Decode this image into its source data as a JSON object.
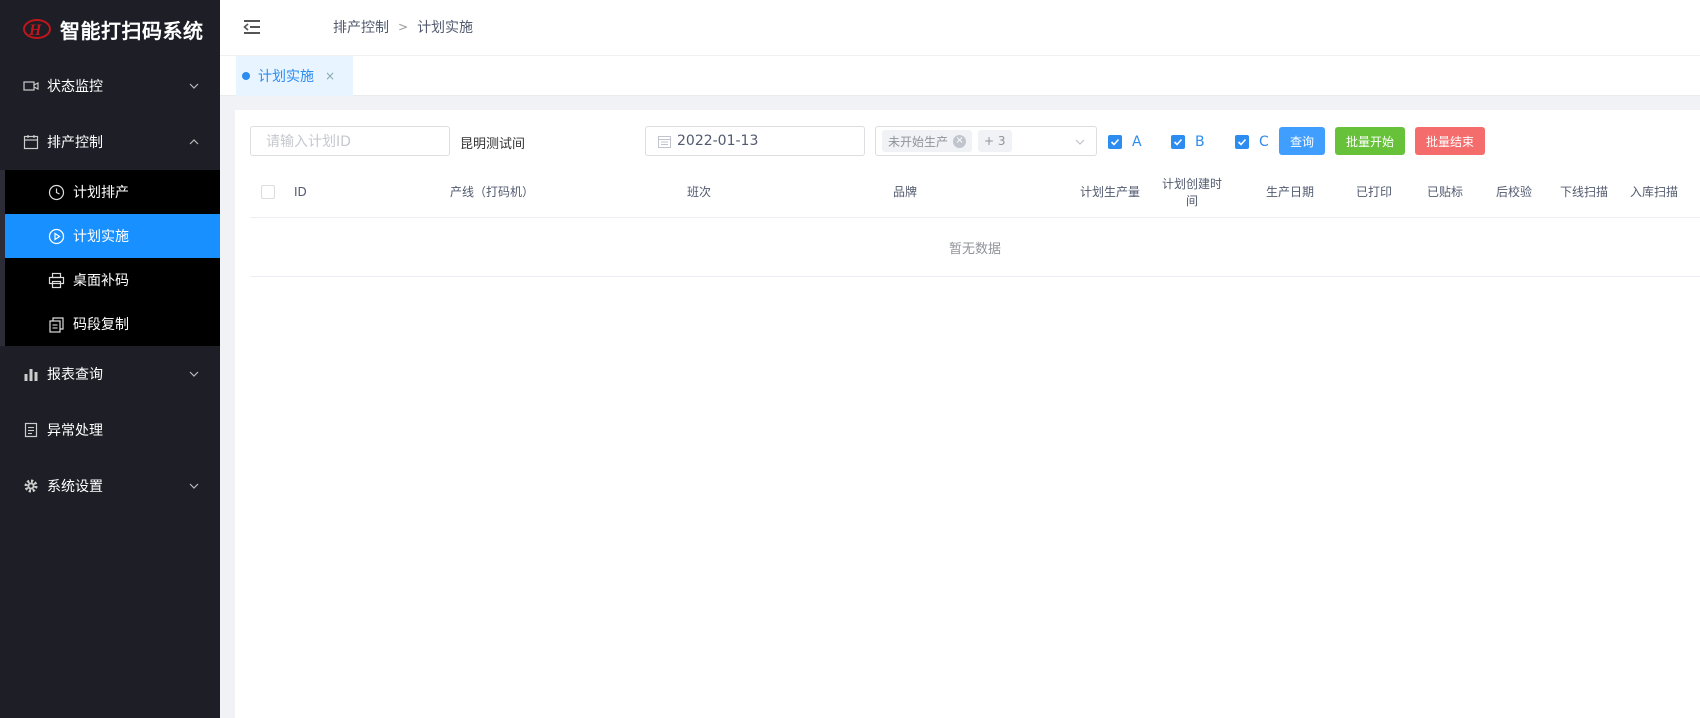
{
  "app": {
    "title": "智能打扫码系统"
  },
  "sidebar": {
    "items": [
      {
        "label": "状态监控",
        "icon": "video-camera-icon"
      },
      {
        "label": "排产控制",
        "icon": "calendar-icon"
      },
      {
        "label": "报表查询",
        "icon": "bar-chart-icon"
      },
      {
        "label": "异常处理",
        "icon": "document-icon"
      },
      {
        "label": "系统设置",
        "icon": "gear-icon"
      }
    ],
    "submenu": [
      {
        "label": "计划排产",
        "icon": "clock-icon"
      },
      {
        "label": "计划实施",
        "icon": "play-circle-icon",
        "active": true
      },
      {
        "label": "桌面补码",
        "icon": "printer-icon"
      },
      {
        "label": "码段复制",
        "icon": "copy-icon"
      }
    ]
  },
  "header": {
    "breadcrumb": [
      "排产控制",
      "计划实施"
    ]
  },
  "tabs": [
    {
      "label": "计划实施",
      "close": "×"
    }
  ],
  "filters": {
    "plan_id_placeholder": "请输入计划ID",
    "workshop": "昆明测试间",
    "date": "2022-01-13",
    "status_tag": "未开始生产",
    "more_tag": "+ 3",
    "checks": [
      "A",
      "B",
      "C"
    ],
    "query_label": "查询",
    "batch_start_label": "批量开始",
    "batch_end_label": "批量结束"
  },
  "table": {
    "columns": [
      "ID",
      "产线（打码机）",
      "班次",
      "品牌",
      "计划生产量",
      "计划创建时间",
      "生产日期",
      "已打印",
      "已贴标",
      "后校验",
      "下线扫描",
      "入库扫描"
    ],
    "empty_text": "暂无数据"
  },
  "colors": {
    "sidebar_bg": "#1d1e26",
    "active_blue": "#1890ff",
    "link_blue": "#2d8cf0",
    "query_btn": "#409eff",
    "start_btn": "#67c23a",
    "end_btn": "#f56c6c"
  }
}
